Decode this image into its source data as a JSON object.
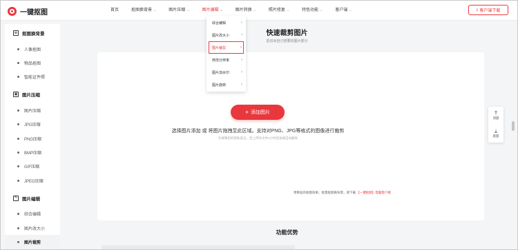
{
  "app": {
    "name": "一键抠图"
  },
  "nav": [
    {
      "label": "首页",
      "caret": false,
      "active": false
    },
    {
      "label": "抠图换背景",
      "caret": true,
      "active": false
    },
    {
      "label": "图片压缩",
      "caret": true,
      "active": false
    },
    {
      "label": "图片编辑",
      "caret": true,
      "active": true
    },
    {
      "label": "图片转换",
      "caret": true,
      "active": false
    },
    {
      "label": "照片修复",
      "caret": true,
      "active": false
    },
    {
      "label": "特色功能",
      "caret": true,
      "active": false
    },
    {
      "label": "客户端",
      "caret": true,
      "active": false
    }
  ],
  "download_button": "客户端下载",
  "dropdown": [
    {
      "label": "综合编辑",
      "active": false
    },
    {
      "label": "图片改大小",
      "active": false
    },
    {
      "label": "图片裁剪",
      "active": true
    },
    {
      "label": "修改分辨率",
      "active": false
    },
    {
      "label": "图片加水印",
      "active": false
    },
    {
      "label": "图片旋转",
      "active": false
    }
  ],
  "sidebar": {
    "sections": [
      {
        "title": "抠图换背景",
        "icon": "cutout-icon",
        "items": [
          "人像抠图",
          "物品抠图",
          "智能证件照"
        ]
      },
      {
        "title": "图片压缩",
        "icon": "compress-icon",
        "items": [
          "图片压缩",
          "JPG压缩",
          "PNG压缩",
          "BMP压缩",
          "GIF压缩",
          "JPEG压缩"
        ]
      },
      {
        "title": "图片编辑",
        "icon": "edit-icon",
        "items": [
          "综合编辑",
          "图片改大小",
          "图片裁剪"
        ]
      }
    ],
    "active_item": "图片裁剪"
  },
  "main": {
    "title": "快速裁剪图片",
    "subtitle": "剪切出自己想要的图片部分",
    "add_button": "添加图片",
    "hint": "选择图片添加 或 将图片拖拽至此区域。支持对PNG、JPG等格式的图像进行裁剪",
    "privacy": "为保障您的隐私安全，您上传的文件1小时后会被自动删除",
    "more_prefix": "更精准的抠图效果，批量抠图换背景，请下载",
    "more_link": "【一键抠图】电脑客户端",
    "features_title": "功能优势"
  },
  "float": {
    "top_label": "顶部",
    "bottom_label": "底部"
  },
  "colors": {
    "accent": "#e8383d"
  }
}
